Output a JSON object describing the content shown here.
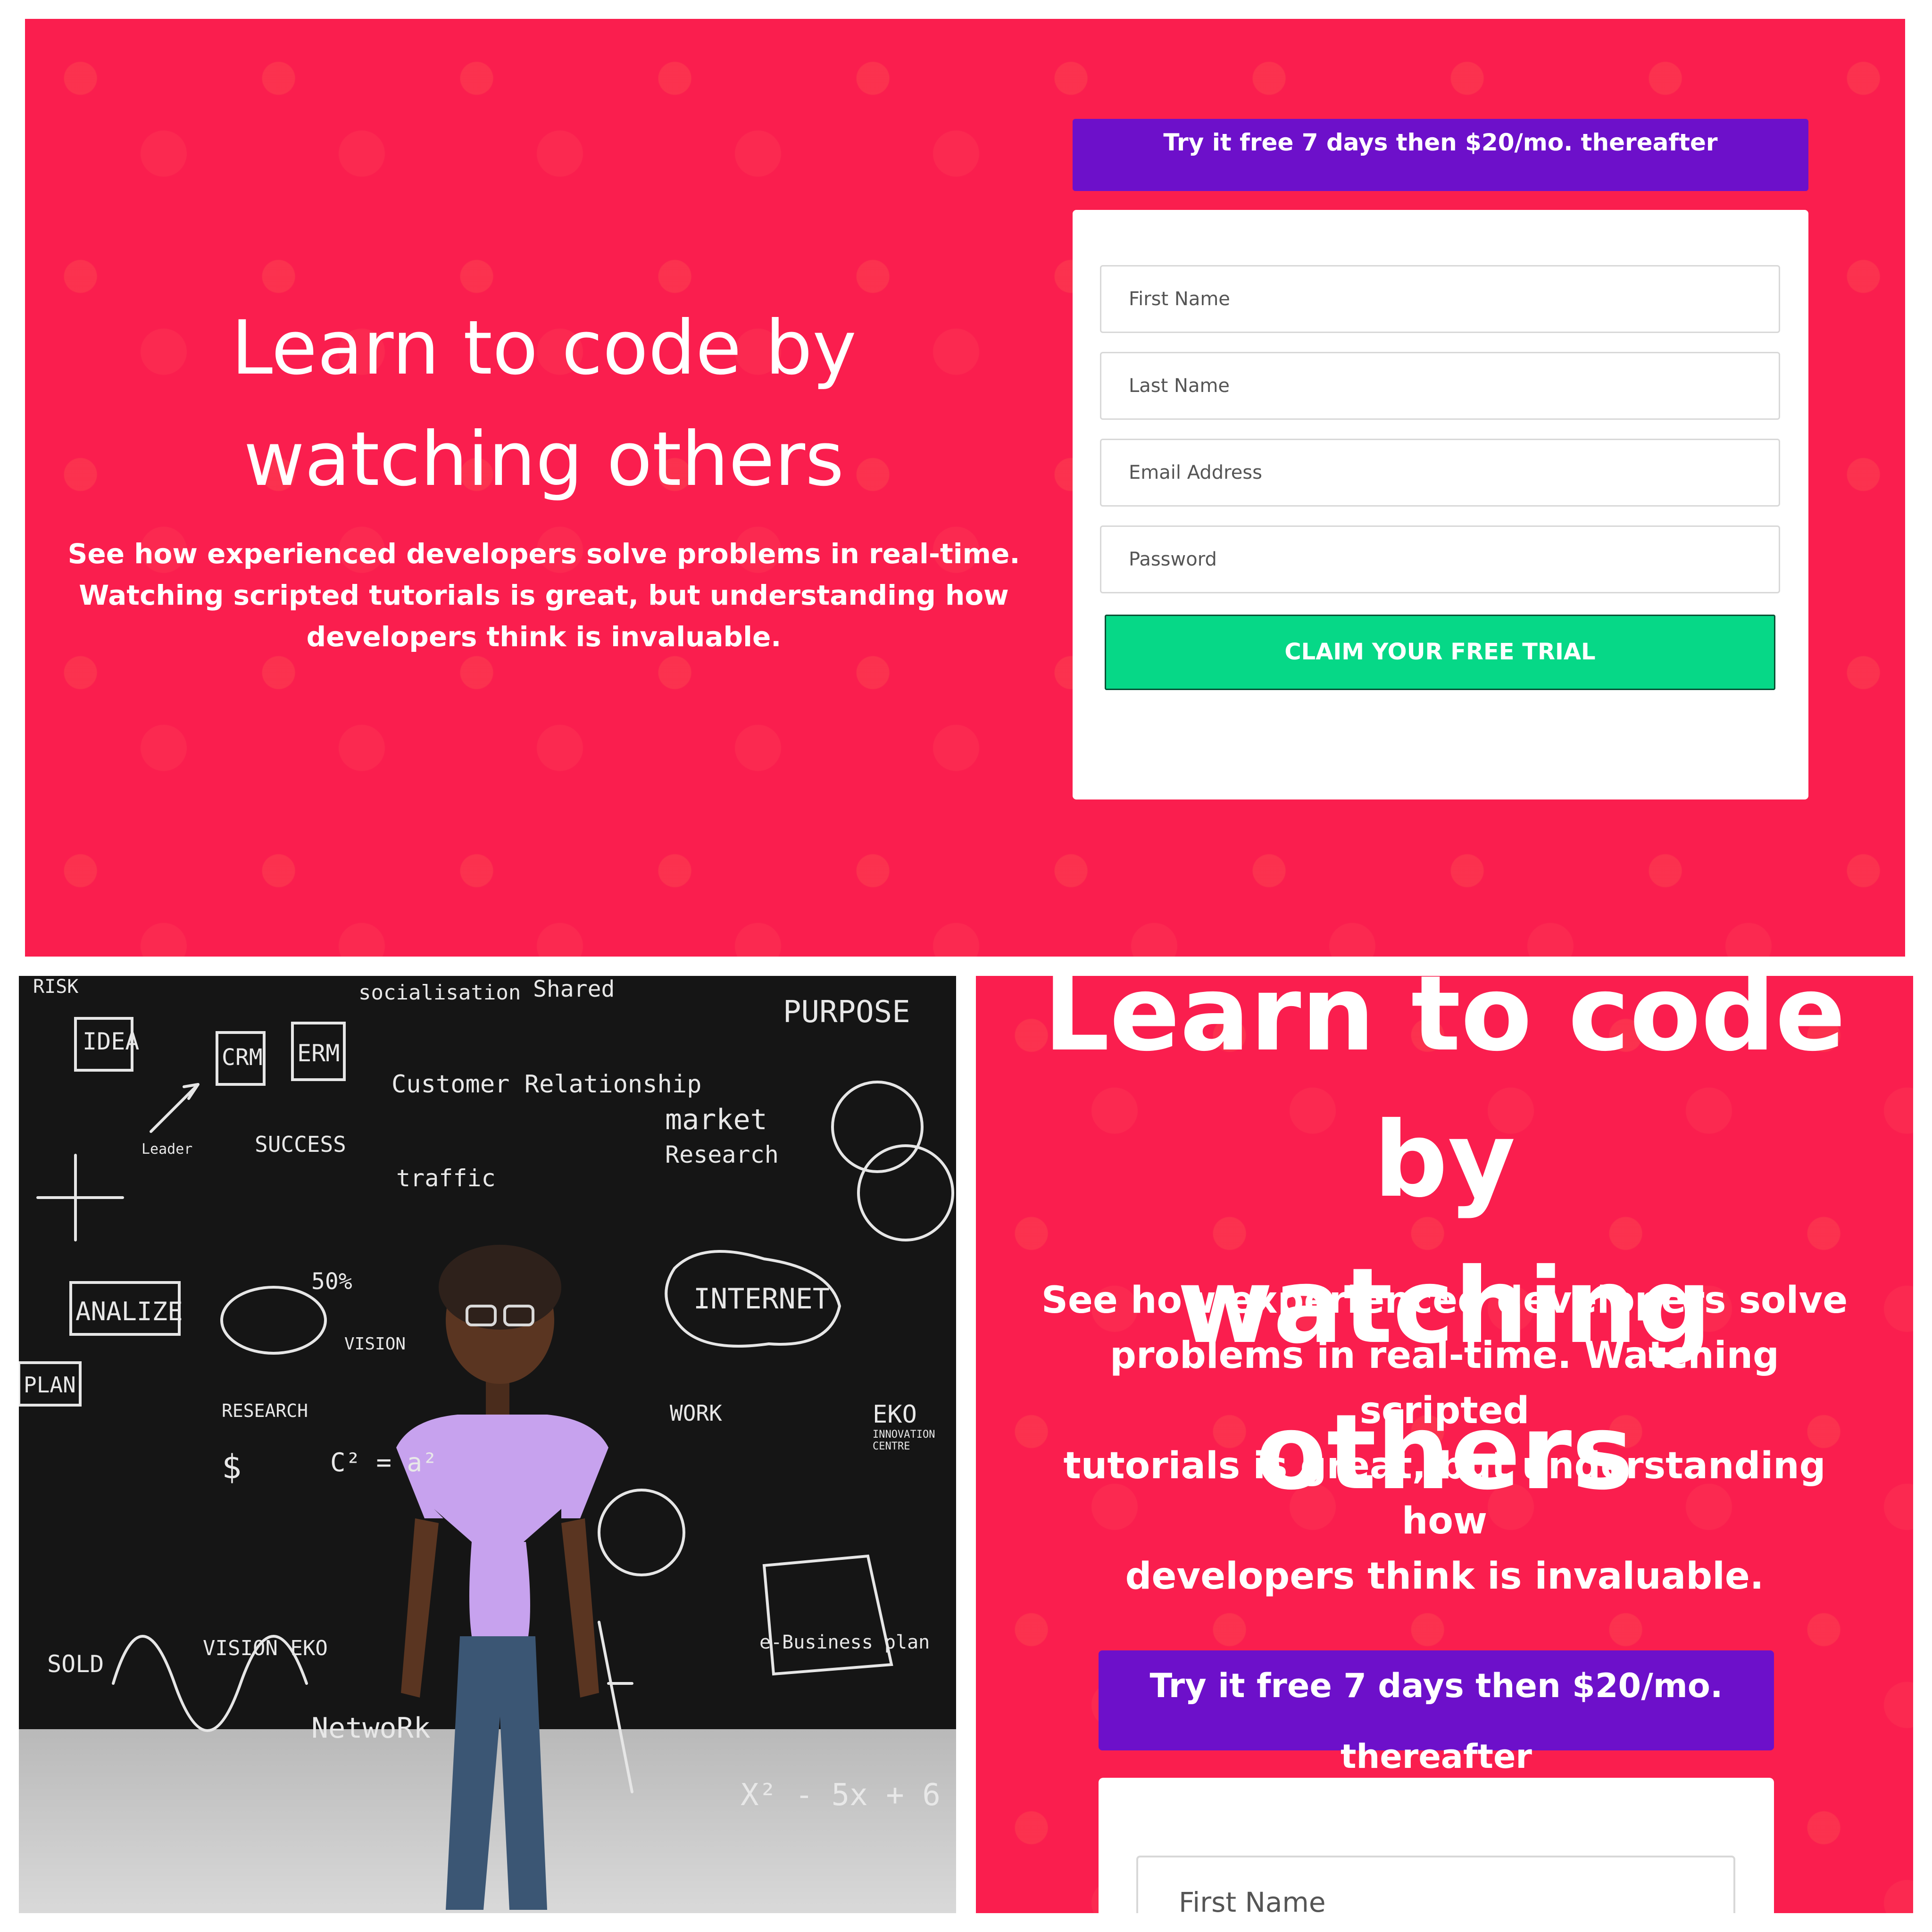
{
  "top": {
    "headline_line1": "Learn to code by",
    "headline_line2": "watching others",
    "sub_line1": "See how experienced developers solve problems in real-time.",
    "sub_line2": "Watching scripted tutorials is great, but understanding how",
    "sub_line3": "developers think is invaluable.",
    "trial_banner": "Try it free 7 days then $20/mo. thereafter",
    "fields": {
      "first_name": "First Name",
      "last_name": "Last Name",
      "email": "Email Address",
      "password": "Password"
    },
    "cta": "CLAIM YOUR FREE TRIAL"
  },
  "photo": {
    "board_words": {
      "risk": "RISK",
      "idea": "IDEA",
      "crm": "CRM",
      "erm": "ERM",
      "socialisation": "socialisation",
      "shared": "Shared",
      "purpose": "PURPOSE",
      "customer": "Customer Relationship",
      "market": "market",
      "research": "Research",
      "success": "SUCCESS",
      "leader": "Leader",
      "traffic": "traffic",
      "analize": "ANALIZE",
      "plan": "PLAN",
      "percent": "50%",
      "internet": "INTERNET",
      "vision": "VISION",
      "research2": "RESEARCH",
      "work": "WORK",
      "eko": "EKO",
      "innovation_centre": "INNOVATION CENTRE",
      "sold": "SOLD",
      "vision_eko": "VISION EKO",
      "network": "NetwoRk",
      "ebusiness": "e-Business plan",
      "formula": "C² = a²",
      "dollar": "$",
      "x_eq": "X² - 5x + 6"
    }
  },
  "zoom": {
    "headline_line1": "Learn to code by",
    "headline_line2": "watching others",
    "sub_line1": "See how experienced developers solve",
    "sub_line2": "problems in real-time. Watching scripted",
    "sub_line3": "tutorials is great, but understanding how",
    "sub_line4": "developers think is invaluable.",
    "trial_banner": "Try it free 7 days then $20/mo. thereafter",
    "first_name": "First Name"
  },
  "colors": {
    "hero_bg": "#fa1e4e",
    "banner": "#6d10ca",
    "cta": "#06d887",
    "card": "#ffffff"
  }
}
